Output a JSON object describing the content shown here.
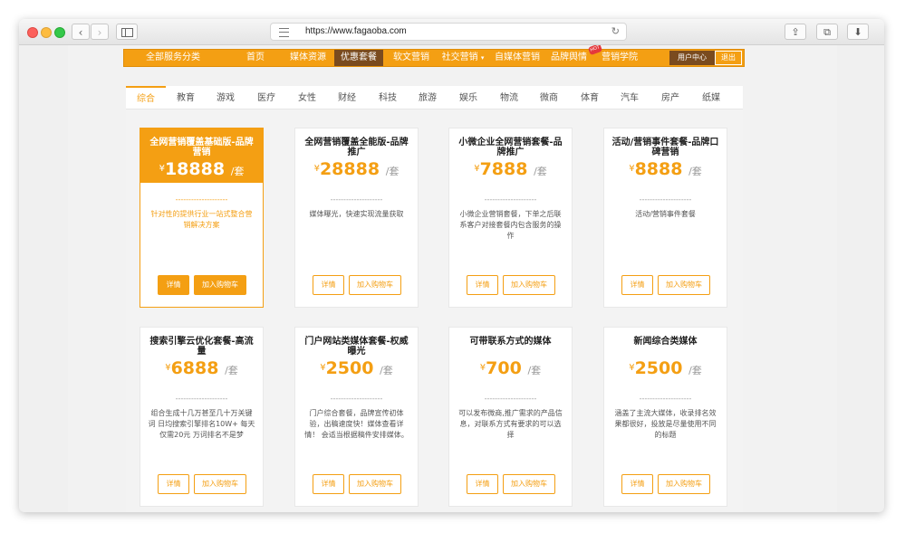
{
  "browser": {
    "url": "https://www.fagaoba.com",
    "reload_icon": "↻",
    "back_icon": "‹",
    "forward_icon": "›",
    "share_icon": "⇪",
    "tabs_icon": "⧉",
    "download_icon": "⬇"
  },
  "site_nav": {
    "all_services": "全部服务分类",
    "items": [
      "首页",
      "媒体资源",
      "优惠套餐",
      "软文营销",
      "社交营销",
      "自媒体营销",
      "品牌舆情",
      "营销学院"
    ],
    "active_index": 2,
    "dropdown_arrow": "▾",
    "hot_badge": "HOT",
    "user_center": "用户中心",
    "logout": "退出"
  },
  "category_tabs": [
    "综合",
    "教育",
    "游戏",
    "医疗",
    "女性",
    "财经",
    "科技",
    "旅游",
    "娱乐",
    "物流",
    "微商",
    "体育",
    "汽车",
    "房产",
    "纸媒"
  ],
  "active_tab": 0,
  "packages": [
    {
      "title": "全网营销覆盖基础版-品牌营销",
      "currency": "¥",
      "price": "18888",
      "unit": "/套",
      "divider": "--------------------",
      "desc": "针对性的提供行业一站式整合营销解决方案",
      "detail": "详情",
      "cart": "加入购物车"
    },
    {
      "title": "全网营销覆盖全能版-品牌推广",
      "currency": "¥",
      "price": "28888",
      "unit": "/套",
      "divider": "--------------------",
      "desc": "媒体曝光，快速实现流量获取",
      "detail": "详情",
      "cart": "加入购物车"
    },
    {
      "title": "小微企业全网营销套餐-品牌推广",
      "currency": "¥",
      "price": "7888",
      "unit": "/套",
      "divider": "--------------------",
      "desc": "小微企业营销套餐，下单之后联系客户对接套餐内包含服务的操作",
      "detail": "详情",
      "cart": "加入购物车"
    },
    {
      "title": "活动/营销事件套餐-品牌口碑营销",
      "currency": "¥",
      "price": "8888",
      "unit": "/套",
      "divider": "--------------------",
      "desc": "活动/营销事件套餐",
      "detail": "详情",
      "cart": "加入购物车"
    },
    {
      "title": "搜索引擎云优化套餐-高流量",
      "currency": "¥",
      "price": "6888",
      "unit": "/套",
      "divider": "--------------------",
      "desc": "组合生成十几万甚至几十万关键词 日均搜索引擎排名10W+ 每天仅需20元 万词排名不是梦",
      "detail": "详情",
      "cart": "加入购物车"
    },
    {
      "title": "门户网站类媒体套餐-权威曝光",
      "currency": "¥",
      "price": "2500",
      "unit": "/套",
      "divider": "--------------------",
      "desc": "门户综合套餐，品牌宣传初体验，出稿速度快！媒体查看详情！ 会适当根据稿件安排媒体。",
      "detail": "详情",
      "cart": "加入购物车"
    },
    {
      "title": "可带联系方式的媒体",
      "currency": "¥",
      "price": "700",
      "unit": "/套",
      "divider": "--------------------",
      "desc": "可以发布微商,推广需求的产品信息，对联系方式有要求的可以选择",
      "detail": "详情",
      "cart": "加入购物车"
    },
    {
      "title": "新闻综合类媒体",
      "currency": "¥",
      "price": "2500",
      "unit": "/套",
      "divider": "--------------------",
      "desc": "涵盖了主流大媒体，收录排名效果都很好，投放是尽量使用不同的标题",
      "detail": "详情",
      "cart": "加入购物车"
    }
  ],
  "active_package": 0
}
